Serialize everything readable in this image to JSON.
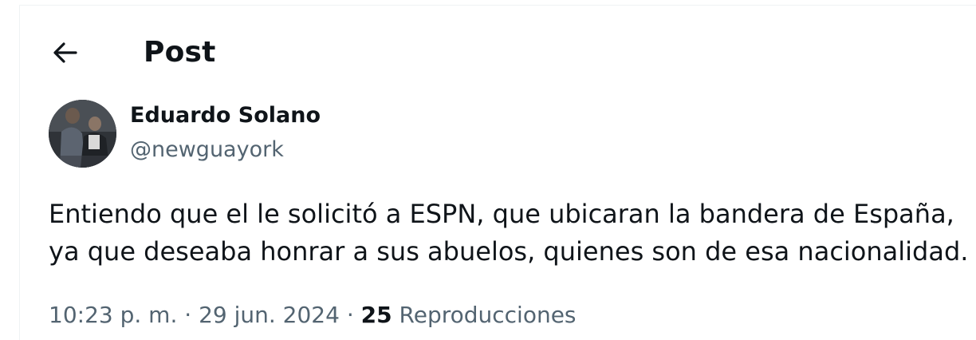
{
  "header": {
    "back_icon": "arrow-left-icon",
    "title": "Post"
  },
  "post": {
    "author": {
      "name": "Eduardo Solano",
      "handle": "@newguayork",
      "avatar_icon": "profile-photo"
    },
    "text_lines": [
      "Entiendo que el le solicitó a ESPN, que ubicaran la bandera de España,",
      "ya que deseaba honrar a sus abuelos, quienes son de esa nacionalidad."
    ],
    "meta": {
      "time": "10:23 p. m.",
      "separator": "·",
      "date": "29 jun. 2024",
      "views_count": "25",
      "views_label": "Reproducciones"
    }
  },
  "colors": {
    "text_primary": "#0f1419",
    "text_secondary": "#536471",
    "border": "#eff3f4",
    "background": "#ffffff"
  }
}
